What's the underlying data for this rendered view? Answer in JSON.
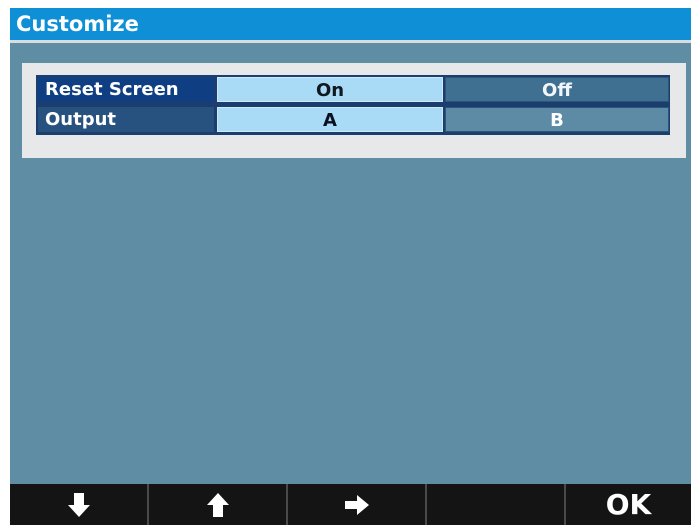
{
  "title": "Customize",
  "settings": [
    {
      "label": "Reset Screen",
      "options": [
        "On",
        "Off"
      ],
      "selected": 0
    },
    {
      "label": "Output",
      "options": [
        "A",
        "B"
      ],
      "selected": 0
    }
  ],
  "footer": {
    "buttons": [
      {
        "icon": "arrow-down-icon"
      },
      {
        "icon": "arrow-up-icon"
      },
      {
        "icon": "arrow-right-icon"
      },
      {
        "icon": ""
      },
      {
        "label": "OK"
      }
    ]
  },
  "colors": {
    "titlebar": "#0e8fd6",
    "screen_bg": "#5f8da3",
    "selected_option": "#a9daf6",
    "row_label": "#0f3f82",
    "footer": "#141414"
  }
}
